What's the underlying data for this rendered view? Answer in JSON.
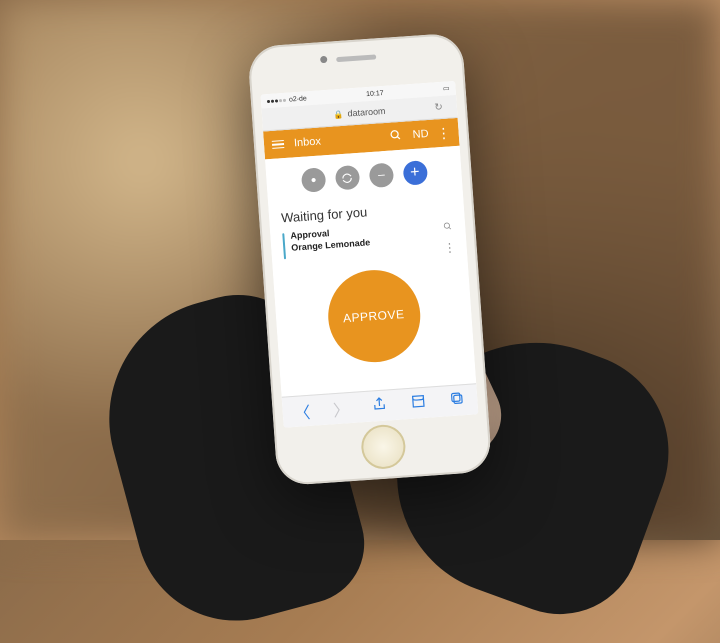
{
  "status": {
    "carrier": "o2-de",
    "time": "10:17"
  },
  "browser": {
    "domain": "dataroom"
  },
  "header": {
    "title": "Inbox",
    "user_initials": "ND"
  },
  "actions": {
    "plus_label": "+"
  },
  "section": {
    "title": "Waiting for you"
  },
  "item": {
    "line1": "Approval",
    "line2": "Orange Lemonade"
  },
  "approve": {
    "label": "APPROVE"
  }
}
